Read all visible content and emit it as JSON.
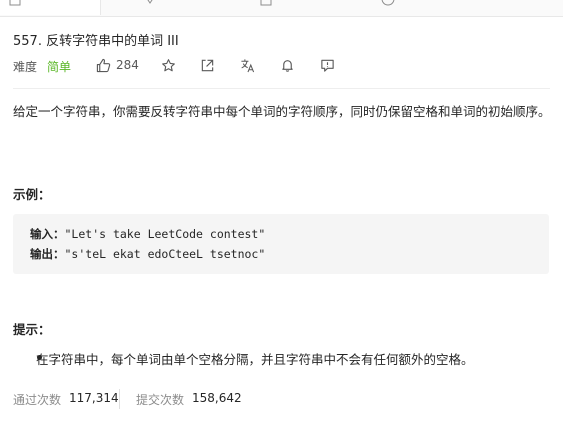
{
  "problem": {
    "title": "557. 反转字符串中的单词 III",
    "difficulty_label": "难度",
    "difficulty": "简单",
    "likes": "284",
    "description": "给定一个字符串，你需要反转字符串中每个单词的字符顺序，同时仍保留空格和单词的初始顺序。",
    "example_heading": "示例：",
    "example": {
      "input_label": "输入：",
      "input_value": "\"Let's take LeetCode contest\"",
      "output_label": "输出：",
      "output_value": "\"s'teL ekat edoCteeL tsetnoc\""
    },
    "tip_heading": "提示：",
    "tips": [
      "在字符串中，每个单词由单个空格分隔，并且字符串中不会有任何额外的空格。"
    ],
    "stats": {
      "accepted_label": "通过次数",
      "accepted_value": "117,314",
      "submissions_label": "提交次数",
      "submissions_value": "158,642"
    }
  },
  "colors": {
    "easy": "#5ab726",
    "muted": "#8c8c8c",
    "code_bg": "#f5f5f5"
  },
  "icons": [
    "thumbs-up-icon",
    "star-icon",
    "share-icon",
    "translate-icon",
    "bell-icon",
    "feedback-icon"
  ]
}
